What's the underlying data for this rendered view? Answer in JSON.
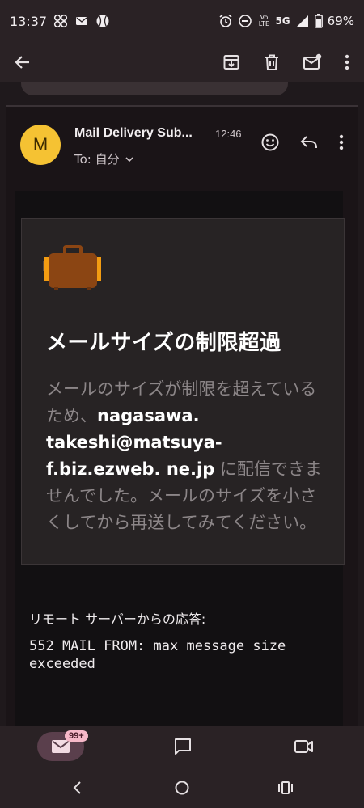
{
  "status_bar": {
    "time": "13:37",
    "battery": "69%",
    "network": "5G",
    "volte": "Vo LTE"
  },
  "email": {
    "avatar_letter": "M",
    "sender": "Mail Delivery Sub...",
    "time": "12:46",
    "to_label": "To: 自分",
    "notice_title": "メールサイズの制限超過",
    "notice_text_1": "メールのサイズが制限を超えているため、",
    "notice_address": "nagasawa. takeshi@matsuya-f.biz.ezweb. ne.jp",
    "notice_text_2": " に配信できませんでした。メールのサイズを小さくしてから再送してみてください。",
    "remote_label": "リモート サーバーからの応答:",
    "remote_message": "552 MAIL FROM: max message size exceeded"
  },
  "bottom_nav": {
    "mail_badge": "99+"
  },
  "colors": {
    "background": "#2a2225",
    "avatar": "#f5c233",
    "notice_panel": "#272324",
    "badge": "#f6b8c8"
  }
}
